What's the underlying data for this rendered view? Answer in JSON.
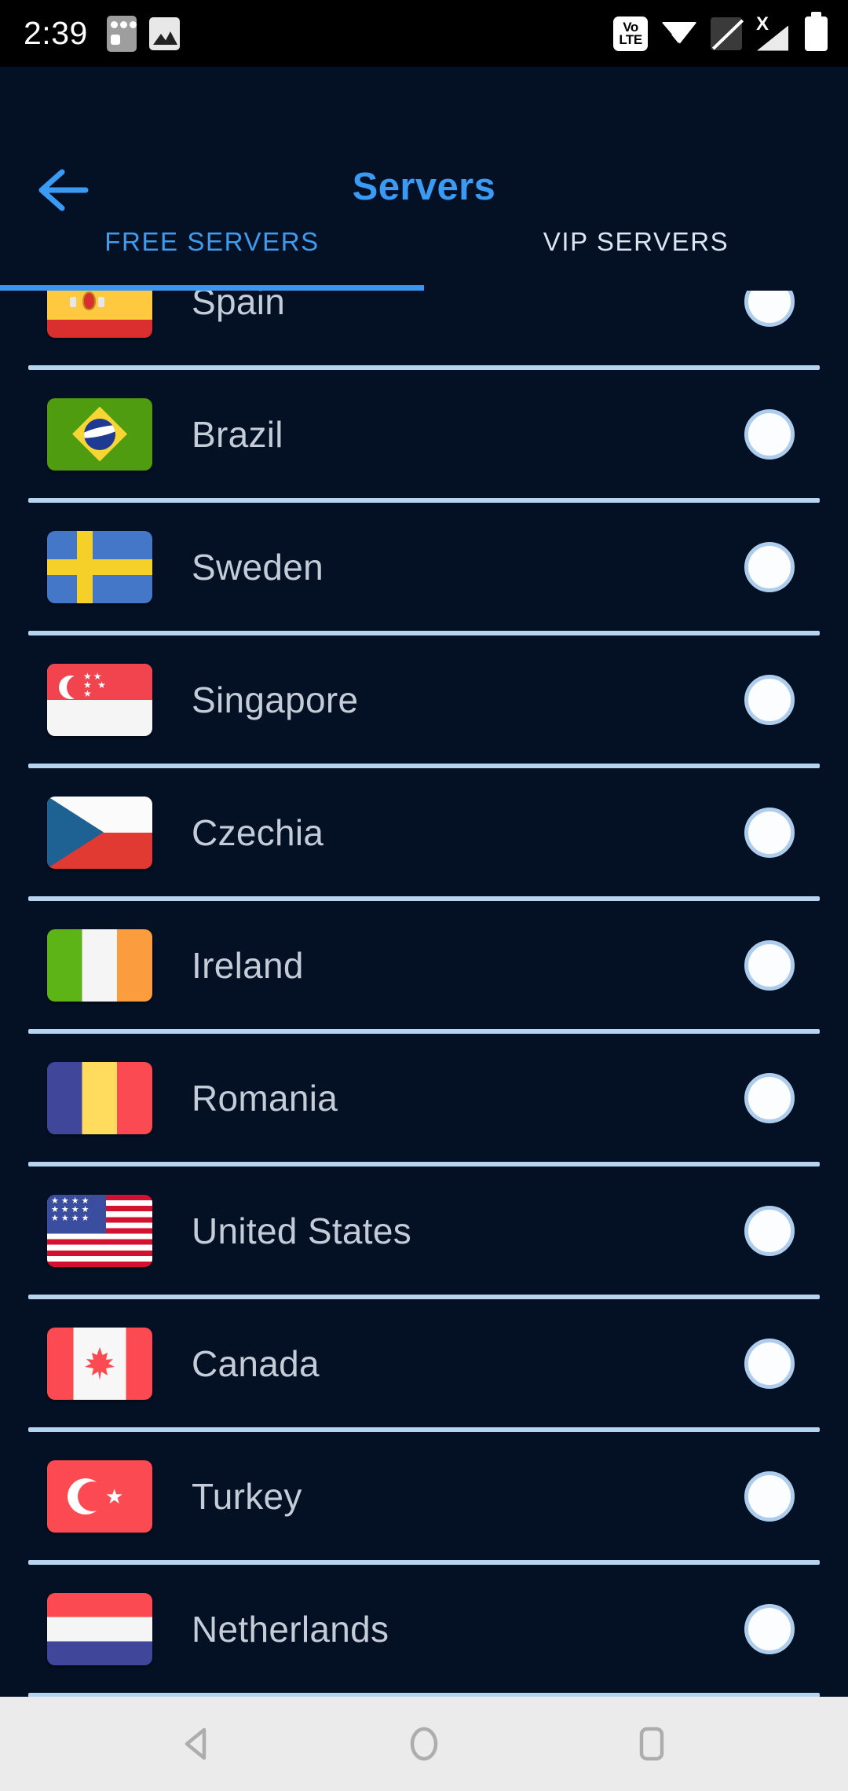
{
  "statusbar": {
    "clock": "2:39",
    "left_icons": [
      {
        "name": "apps-icon",
        "glyph": "apps"
      },
      {
        "name": "photo-icon",
        "glyph": "image"
      }
    ],
    "right_icons": [
      {
        "name": "volte-icon",
        "line1": "Vo",
        "line2": "LTE"
      },
      {
        "name": "wifi-icon",
        "glyph": "wifi"
      },
      {
        "name": "sim-off-icon",
        "glyph": "no-sim"
      },
      {
        "name": "signal-x-icon",
        "glyph": "no-signal",
        "badge": "X"
      },
      {
        "name": "battery-icon",
        "glyph": "battery-full"
      }
    ]
  },
  "header": {
    "back_icon": "arrow-left-icon",
    "title": "Servers",
    "title_color": "#3a9bf4"
  },
  "tabs": {
    "active_index": 0,
    "items": [
      {
        "label": "FREE SERVERS",
        "active": true
      },
      {
        "label": "VIP SERVERS",
        "active": false
      }
    ],
    "indicator_color": "#3b96ec"
  },
  "servers": {
    "divider_color": "#b6d3ef",
    "radio_fill": "#fcfdff",
    "radio_ring": "#aecdec",
    "items": [
      {
        "name": "Spain",
        "flag": "f-es",
        "selected": false,
        "partial": true
      },
      {
        "name": "Brazil",
        "flag": "f-br",
        "selected": false
      },
      {
        "name": "Sweden",
        "flag": "f-se",
        "selected": false
      },
      {
        "name": "Singapore",
        "flag": "f-sg",
        "selected": false
      },
      {
        "name": "Czechia",
        "flag": "f-cz",
        "selected": false
      },
      {
        "name": "Ireland",
        "flag": "f-ie",
        "selected": false
      },
      {
        "name": "Romania",
        "flag": "f-ro",
        "selected": false
      },
      {
        "name": "United States",
        "flag": "f-us",
        "selected": false
      },
      {
        "name": "Canada",
        "flag": "f-ca",
        "selected": false
      },
      {
        "name": "Turkey",
        "flag": "f-tr",
        "selected": false
      },
      {
        "name": "Netherlands",
        "flag": "f-nl",
        "selected": false
      }
    ]
  },
  "navbar": {
    "items": [
      {
        "name": "nav-back-icon",
        "glyph": "triangle-left"
      },
      {
        "name": "nav-home-icon",
        "glyph": "circle"
      },
      {
        "name": "nav-recents-icon",
        "glyph": "rounded-square"
      }
    ]
  },
  "colors": {
    "background": "#041024",
    "accent": "#3a9bf4",
    "text_primary": "#c3ccd7",
    "navbar_bg": "#ebebeb"
  }
}
